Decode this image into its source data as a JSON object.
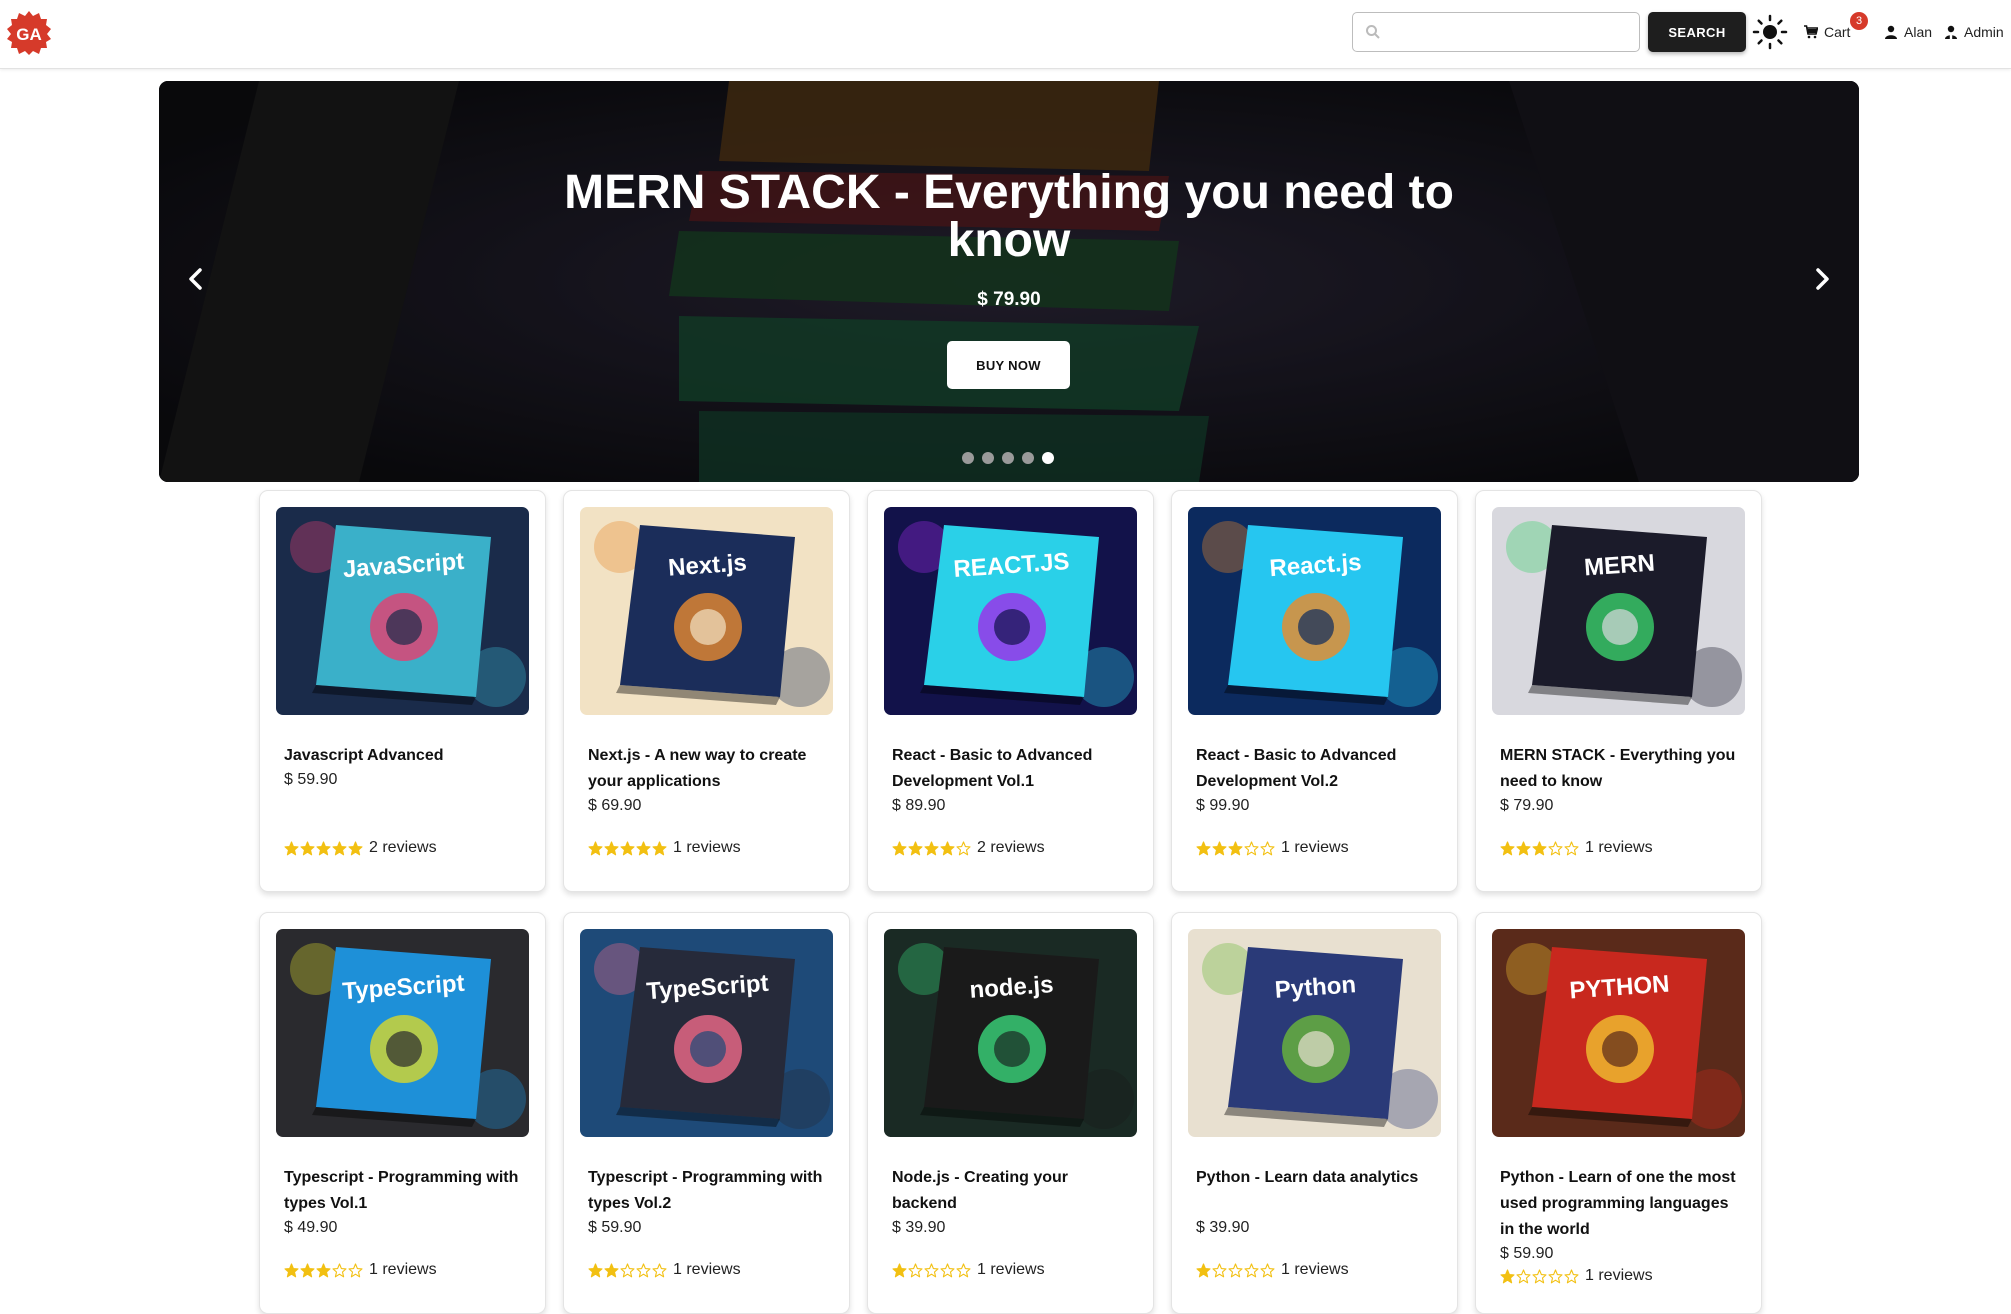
{
  "header": {
    "logo_text": "GA",
    "search": {
      "placeholder": "",
      "value": ""
    },
    "search_button": "SEARCH",
    "cart": {
      "label": "Cart",
      "count": "3"
    },
    "user_label": "Alan",
    "admin_label": "Admin"
  },
  "carousel": {
    "title": "MERN STACK - Everything you need to know",
    "price": "$ 79.90",
    "buy_label": "BUY NOW",
    "slide_count": 5,
    "active_slide": 5
  },
  "products": [
    {
      "name": "Javascript Advanced",
      "price": "$ 59.90",
      "rating": 5,
      "reviews": "2 reviews"
    },
    {
      "name": "Next.js - A new way to create your applications",
      "price": "$ 69.90",
      "rating": 5,
      "reviews": "1 reviews"
    },
    {
      "name": "React - Basic to Advanced Development Vol.1",
      "price": "$ 89.90",
      "rating": 4,
      "reviews": "2 reviews"
    },
    {
      "name": "React - Basic to Advanced Development Vol.2",
      "price": "$ 99.90",
      "rating": 3,
      "reviews": "1 reviews"
    },
    {
      "name": "MERN STACK - Everything you need to know",
      "price": "$ 79.90",
      "rating": 3,
      "reviews": "1 reviews"
    },
    {
      "name": "Typescript - Programming with types Vol.1",
      "price": "$ 49.90",
      "rating": 3,
      "reviews": "1 reviews"
    },
    {
      "name": "Typescript - Programming with types Vol.2",
      "price": "$ 59.90",
      "rating": 2,
      "reviews": "1 reviews"
    },
    {
      "name": "Node.js - Creating your backend",
      "price": "$ 39.90",
      "rating": 1,
      "reviews": "1 reviews"
    },
    {
      "name": "Python - Learn data analytics",
      "price": "$ 39.90",
      "rating": 1,
      "reviews": "1 reviews"
    },
    {
      "name": "Python - Learn of one the most used programming languages in the world",
      "price": "$ 59.90",
      "rating": 1,
      "reviews": "1 reviews"
    }
  ],
  "cover_labels": [
    "JavaScript",
    "Next.js",
    "REACT.JS",
    "React.js",
    "MERN",
    "TypeScript",
    "TypeScript",
    "node.js",
    "Python",
    "PYTHON"
  ],
  "colors": {
    "accent_dark": "#1e1e1e",
    "badge": "#d63a2a",
    "star": "#f2c012",
    "logo": "#d63a2a"
  }
}
